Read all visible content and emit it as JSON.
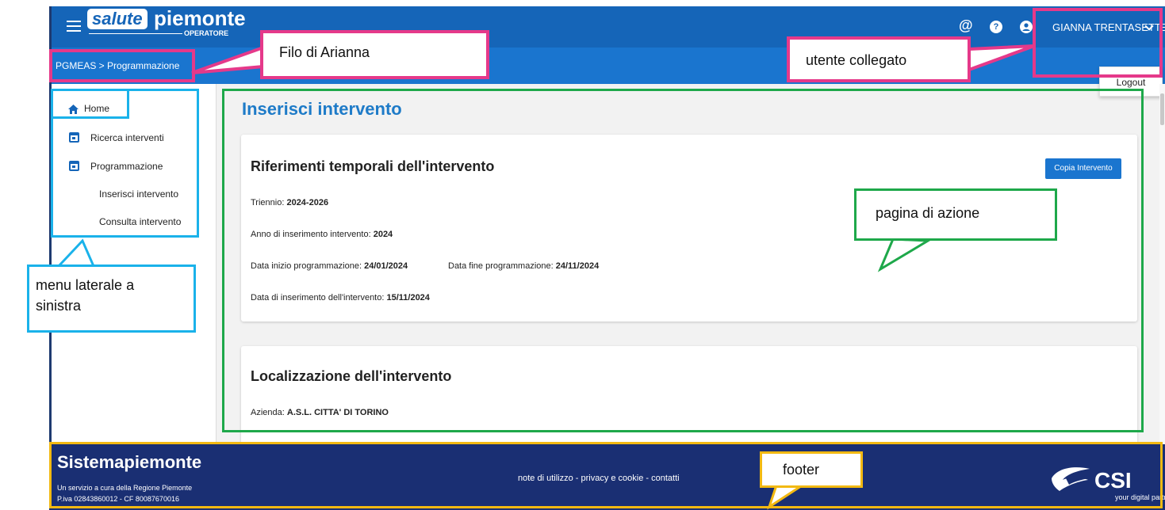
{
  "header": {
    "logo_salute": "salute",
    "logo_piemonte": "piemonte",
    "logo_operatore": "OPERATORE",
    "at_symbol": "@",
    "help_glyph": "?",
    "user_name": "GIANNA TRENTASETTE",
    "logout_label": "Logout",
    "icons": [
      "menu-icon",
      "at-icon",
      "help-icon",
      "user-icon",
      "chevron-down-icon"
    ]
  },
  "breadcrumb": "PGMEAS > Programmazione",
  "sidebar": {
    "items": [
      {
        "label": "Home",
        "icon": "home-icon"
      },
      {
        "label": "Ricerca interventi",
        "icon": "calendar-icon"
      },
      {
        "label": "Programmazione",
        "icon": "calendar-icon"
      },
      {
        "label": "Inserisci intervento"
      },
      {
        "label": "Consulta intervento"
      }
    ]
  },
  "main": {
    "title": "Inserisci intervento",
    "copy_button": "Copia Intervento",
    "card1": {
      "title": "Riferimenti temporali dell'intervento",
      "triennio_label": "Triennio: ",
      "triennio_value": "2024-2026",
      "anno_label": "Anno di inserimento intervento: ",
      "anno_value": "2024",
      "data_inizio_label": "Data inizio programmazione: ",
      "data_inizio_value": "24/01/2024",
      "data_fine_label": "Data fine programmazione: ",
      "data_fine_value": "24/11/2024",
      "data_ins_label": "Data di inserimento dell'intervento: ",
      "data_ins_value": "15/11/2024"
    },
    "card2": {
      "title": "Localizzazione dell'intervento",
      "azienda_label": "Azienda: ",
      "azienda_value": "A.S.L. CITTA' DI TORINO"
    }
  },
  "footer": {
    "brand": "Sistemapiemonte",
    "line1": "Un servizio a cura della Regione Piemonte",
    "line2": "P.iva 02843860012 - CF 80087670016",
    "links": "note di utilizzo - privacy e cookie - contatti",
    "csi_logo": "CSI",
    "csi_tagline": "your digital partner"
  },
  "annotations": {
    "filo": "Filo di Arianna",
    "utente": "utente collegato",
    "pagina": "pagina di azione",
    "menu_line1": "menu laterale a",
    "menu_line2": "sinistra",
    "footer": "footer"
  },
  "colors": {
    "header": "#1565b8",
    "subheader": "#1a75cf",
    "title": "#1e7bc8",
    "footer": "#1a2f73",
    "ann_pink": "#e5398a",
    "ann_blue": "#1ab2ea",
    "ann_green": "#1ea84a",
    "ann_yellow": "#f2b912"
  }
}
